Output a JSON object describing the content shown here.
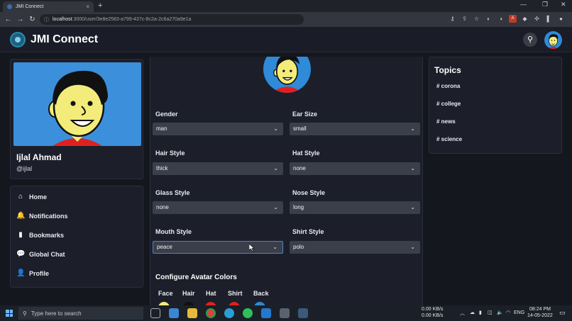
{
  "browser": {
    "tab_title": "JMI Connect",
    "tab_close": "×",
    "new_tab": "+",
    "window_controls": [
      "—",
      "❐",
      "✕"
    ],
    "url_host": "localhost",
    "url_path": ":3000/user/3e8e2583-a799-437c-8c2a-2c6a270a9e1a",
    "nav_icons": [
      "back-icon",
      "forward-icon",
      "reload-icon"
    ]
  },
  "header": {
    "title": "JMI Connect",
    "search_icon": "search-icon"
  },
  "profile": {
    "name": "Ijlal Ahmad",
    "handle": "@ijlal"
  },
  "nav": {
    "items": [
      {
        "icon": "home-icon",
        "glyph": "⌂",
        "label": "Home"
      },
      {
        "icon": "bell-icon",
        "glyph": "🔔",
        "label": "Notifications"
      },
      {
        "icon": "bookmark-icon",
        "glyph": "▮",
        "label": "Bookmarks"
      },
      {
        "icon": "chat-icon",
        "glyph": "💬",
        "label": "Global Chat"
      },
      {
        "icon": "user-icon",
        "glyph": "👤",
        "label": "Profile"
      }
    ]
  },
  "avatar_form": {
    "fields": [
      {
        "label": "Gender",
        "value": "man"
      },
      {
        "label": "Ear Size",
        "value": "small"
      },
      {
        "label": "Hair Style",
        "value": "thick"
      },
      {
        "label": "Hat Style",
        "value": "none"
      },
      {
        "label": "Glass Style",
        "value": "none"
      },
      {
        "label": "Nose Style",
        "value": "long"
      },
      {
        "label": "Mouth Style",
        "value": "peace"
      },
      {
        "label": "Shirt Style",
        "value": "polo"
      }
    ],
    "colors_title": "Configure Avatar Colors",
    "color_labels": [
      "Face",
      "Hair",
      "Hat",
      "Shirt",
      "Back"
    ],
    "color_values": [
      "#f4ec7a",
      "#111111",
      "#e0201e",
      "#e0201e",
      "#2f8ad8"
    ]
  },
  "topics": {
    "title": "Topics",
    "items": [
      "# corona",
      "# college",
      "# news",
      "# science"
    ]
  },
  "taskbar": {
    "search_placeholder": "Type here to search",
    "net_up": "0.00 KB/s",
    "net_down": "0.00 KB/s",
    "language": "ENG",
    "time": "08:24 PM",
    "date": "14-05-2022"
  },
  "colors": {
    "accent": "#2f8ad8",
    "panel": "#1c1f2a",
    "background": "#15171f",
    "select_bg": "#3b3f4a"
  }
}
